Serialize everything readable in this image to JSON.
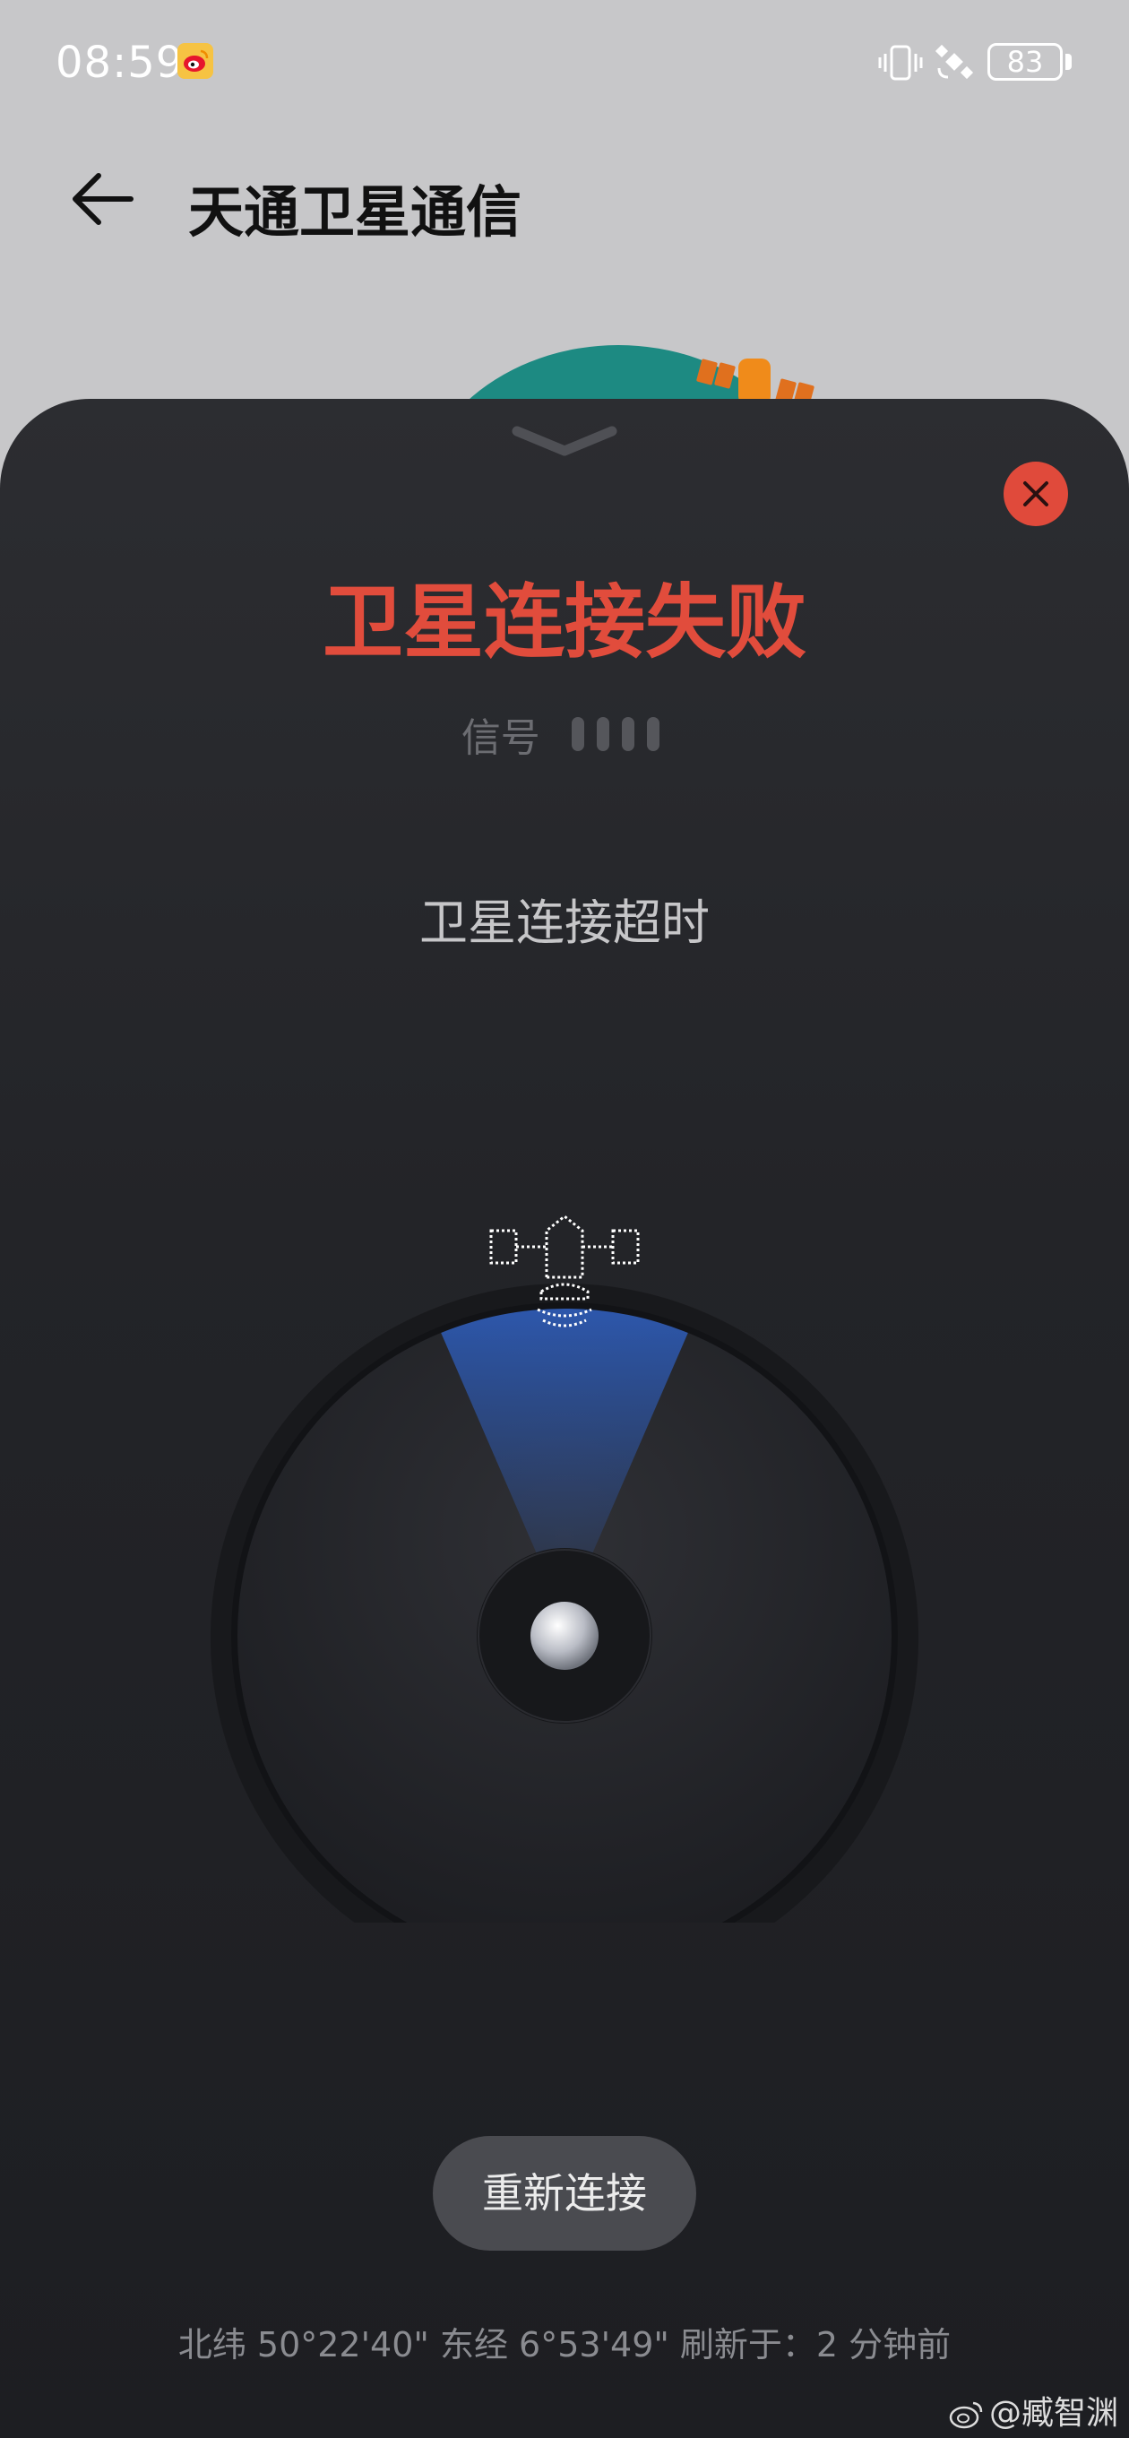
{
  "status_bar": {
    "time": "08:59",
    "battery": "83",
    "icons": [
      "weibo-icon",
      "vibrate-icon",
      "satellite-status-icon",
      "battery-icon"
    ]
  },
  "app_bar": {
    "title": "天通卫星通信",
    "back_icon": "back-arrow-icon"
  },
  "sheet": {
    "status_title": "卫星连接失败",
    "signal_label": "信号",
    "signal_level": 0,
    "signal_bars_total": 4,
    "status_detail": "卫星连接超时",
    "reconnect_label": "重新连接",
    "location_text": "北纬 50°22'40\" 东经 6°53'49\" 刷新于：2 分钟前"
  },
  "watermark": "@臧智渊",
  "colors": {
    "error_red": "#e14c3c",
    "close_red": "#e04a3b",
    "radar_blue": "#2f62c8",
    "sheet_bg": "#232428"
  }
}
